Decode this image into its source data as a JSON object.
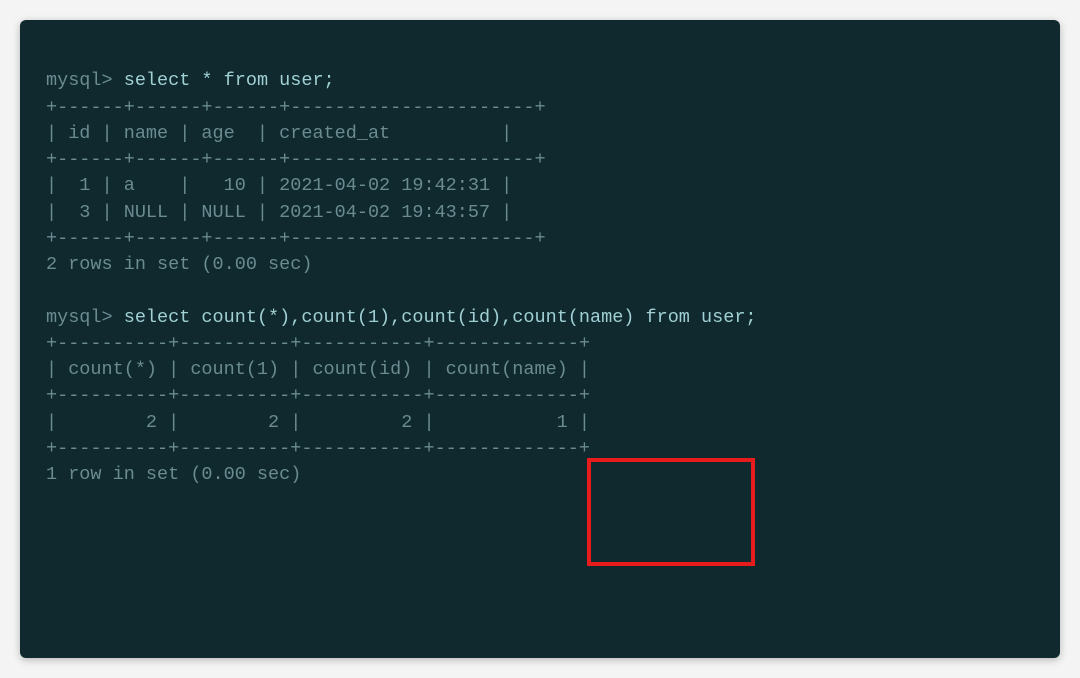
{
  "query1": {
    "prompt": "mysql> ",
    "sql": "select * from user;",
    "border": "+------+------+------+----------------------+",
    "header": "| id | name | age  | created_at          |",
    "rows": [
      "|  1 | a    |   10 | 2021-04-02 19:42:31 |",
      "|  3 | NULL | NULL | 2021-04-02 19:43:57 |"
    ],
    "footer": "2 rows in set (0.00 sec)"
  },
  "query2": {
    "prompt": "mysql> ",
    "sql": "select count(*),count(1),count(id),count(name) from user;",
    "border": "+----------+----------+-----------+-------------+",
    "header": "| count(*) | count(1) | count(id) | count(name) |",
    "rows": [
      "|        2 |        2 |         2 |           1 |"
    ],
    "footer": "1 row in set (0.00 sec)"
  }
}
